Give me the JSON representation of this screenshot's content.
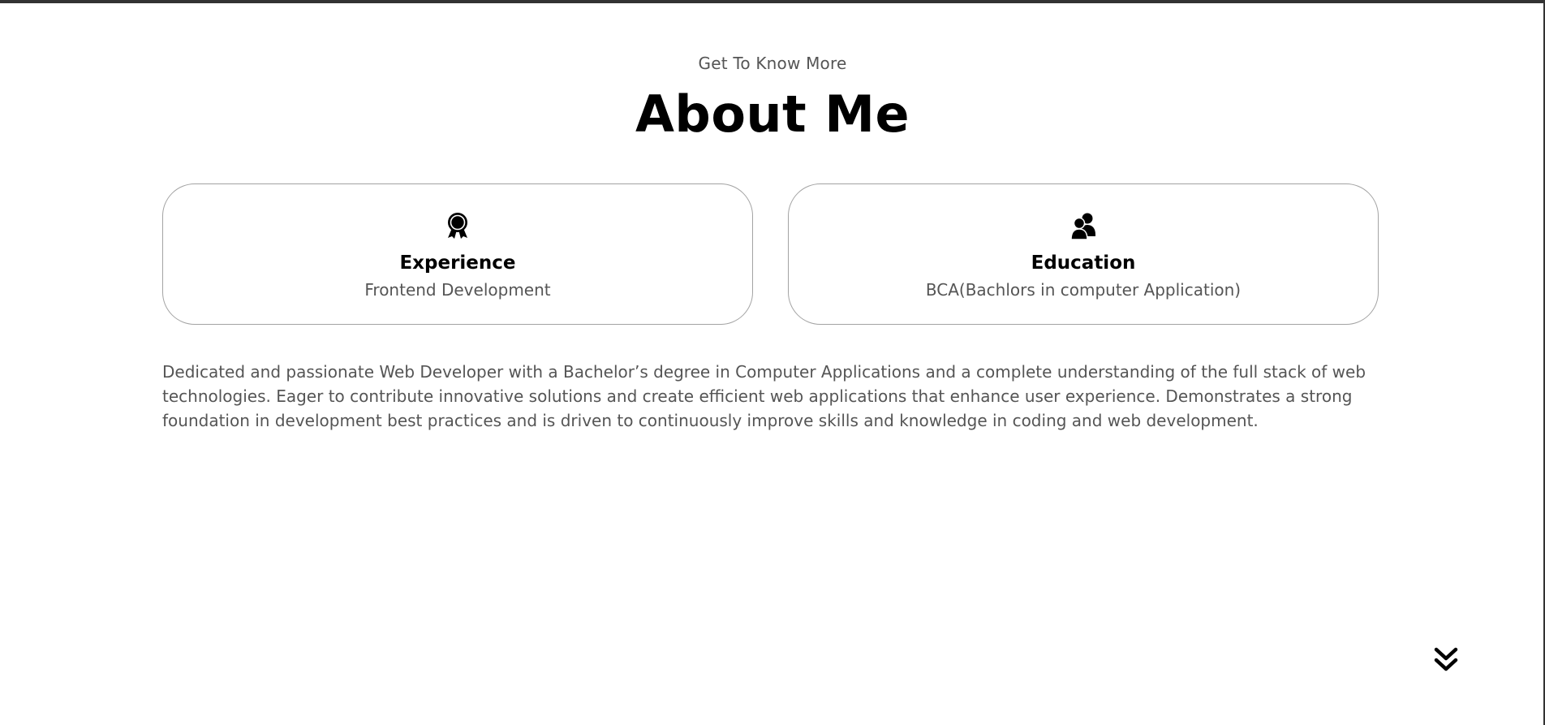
{
  "about": {
    "subtitle": "Get To Know More",
    "title": "About Me"
  },
  "cards": [
    {
      "icon": "award-ribbon-icon",
      "title": "Experience",
      "text": "Frontend Development"
    },
    {
      "icon": "users-icon",
      "title": "Education",
      "text": "BCA(Bachlors in computer Application)"
    }
  ],
  "description": "Dedicated and passionate Web Developer with a Bachelor’s degree in Computer Applications and a complete understanding of the full stack of web technologies. Eager to contribute innovative solutions and create efficient web applications that enhance user experience. Demonstrates a strong foundation in development best practices and is driven to continuously improve skills and knowledge in coding and web development.",
  "navigation": {
    "scroll_icon": "double-chevron-down-icon"
  },
  "colors": {
    "text_primary": "#000000",
    "text_secondary": "#555555",
    "card_border": "#a3a3a3"
  }
}
